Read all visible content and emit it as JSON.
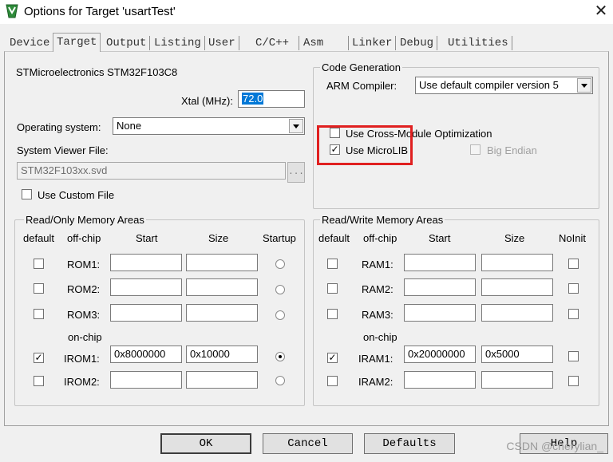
{
  "window": {
    "title": "Options for Target 'usartTest'",
    "close_glyph": "✕"
  },
  "tabs": [
    "Device",
    "Target",
    "Output",
    "Listing",
    "User",
    "C/C++",
    "Asm",
    "Linker",
    "Debug",
    "Utilities"
  ],
  "target": {
    "device_name": "STMicroelectronics STM32F103C8",
    "xtal_label": "Xtal (MHz):",
    "xtal_value": "72.0",
    "os_label": "Operating system:",
    "os_value": "None",
    "svd_label": "System Viewer File:",
    "svd_value": "STM32F103xx.svd",
    "browse_label": "...",
    "custom_file_label": "Use Custom File"
  },
  "codegen": {
    "title": "Code Generation",
    "compiler_label": "ARM Compiler:",
    "compiler_value": "Use default compiler version 5",
    "cross_module_label": "Use Cross-Module Optimization",
    "microlib_label": "Use MicroLIB",
    "microlib_checked": true,
    "big_endian_label": "Big Endian"
  },
  "ro_memory": {
    "title": "Read/Only Memory Areas",
    "headers": {
      "default": "default",
      "offchip": "off-chip",
      "start": "Start",
      "size": "Size",
      "startup": "Startup"
    },
    "onchip_label": "on-chip",
    "rows": [
      {
        "name": "ROM1:",
        "start": "",
        "size": "",
        "default": false,
        "startup": false
      },
      {
        "name": "ROM2:",
        "start": "",
        "size": "",
        "default": false,
        "startup": false
      },
      {
        "name": "ROM3:",
        "start": "",
        "size": "",
        "default": false,
        "startup": false
      },
      {
        "name": "IROM1:",
        "start": "0x8000000",
        "size": "0x10000",
        "default": true,
        "startup": true
      },
      {
        "name": "IROM2:",
        "start": "",
        "size": "",
        "default": false,
        "startup": false
      }
    ]
  },
  "rw_memory": {
    "title": "Read/Write Memory Areas",
    "headers": {
      "default": "default",
      "offchip": "off-chip",
      "start": "Start",
      "size": "Size",
      "noinit": "NoInit"
    },
    "onchip_label": "on-chip",
    "rows": [
      {
        "name": "RAM1:",
        "start": "",
        "size": "",
        "default": false,
        "noinit": false
      },
      {
        "name": "RAM2:",
        "start": "",
        "size": "",
        "default": false,
        "noinit": false
      },
      {
        "name": "RAM3:",
        "start": "",
        "size": "",
        "default": false,
        "noinit": false
      },
      {
        "name": "IRAM1:",
        "start": "0x20000000",
        "size": "0x5000",
        "default": true,
        "noinit": false
      },
      {
        "name": "IRAM2:",
        "start": "",
        "size": "",
        "default": false,
        "noinit": false
      }
    ]
  },
  "buttons": {
    "ok": "OK",
    "cancel": "Cancel",
    "defaults": "Defaults",
    "help": "Help"
  },
  "watermark": "CSDN @cherylian_",
  "colors": {
    "highlight": "#0078d7",
    "annotation_red": "#e02020"
  }
}
